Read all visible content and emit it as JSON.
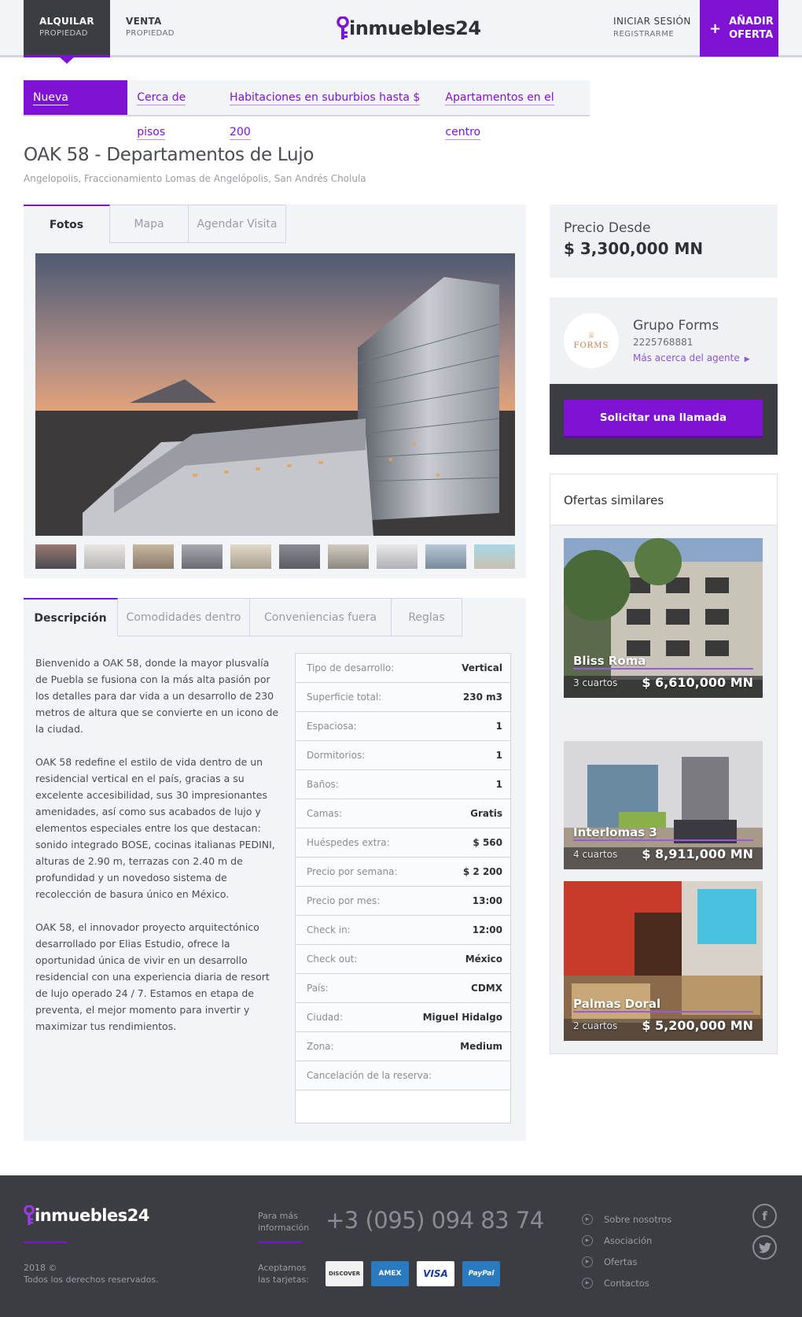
{
  "header": {
    "rent": {
      "title": "ALQUILAR",
      "subtitle": "PROPIEDAD"
    },
    "sale": {
      "title": "VENTA",
      "subtitle": "PROPIEDAD"
    },
    "logo": "inmuebles24",
    "login": "INICIAR SESIÓN",
    "register": "REGISTRARME",
    "add_offer": {
      "plus": "+",
      "line1": "AÑADIR",
      "line2": "OFERTA"
    },
    "accent": "#7f13d4"
  },
  "search_tabs": [
    {
      "label": "Nueva búsqueda",
      "active": true
    },
    {
      "label": "Cerca de pisos"
    },
    {
      "label": "Habitaciones en suburbios hasta $ 200"
    },
    {
      "label": "Apartamentos en el centro"
    }
  ],
  "listing": {
    "title": "OAK 58 - Departamentos de Lujo",
    "address": "Angelopolis, Fraccionamiento Lomas de Angelópolis, San Andrés Cholula"
  },
  "media_tabs": [
    {
      "label": "Fotos",
      "active": true
    },
    {
      "label": "Mapa"
    },
    {
      "label": "Agendar Visita"
    }
  ],
  "desc_tabs": [
    {
      "label": "Descripción",
      "active": true
    },
    {
      "label": "Comodidades dentro"
    },
    {
      "label": "Conveniencias fuera"
    },
    {
      "label": "Reglas"
    }
  ],
  "description": [
    "Bienvenido a OAK 58, donde la mayor plusvalía de Puebla se fusiona con la más alta pasión por los detalles para dar vida a un desarrollo de 230 metros de altura que se convierte en un icono de la ciudad.",
    "OAK 58 redefine el estilo de vida dentro de un residencial vertical en el país, gracias a su excelente accesibilidad, sus 30 impresionantes amenidades, así como sus acabados de lujo y elementos especiales entre los que destacan: sonido integrado BOSE, cocinas italianas PEDINI, alturas de 2.90 m, terrazas con 2.40 m de profundidad y un novedoso sistema de recolección de basura único en México.",
    "OAK 58, el innovador proyecto arquitectónico desarrollado por Elias Estudio, ofrece la oportunidad única de vivir en un desarrollo residencial con una experiencia diaria de resort de lujo operado 24 / 7. Estamos en etapa de preventa, el mejor momento para invertir y maximizar tus rendimientos."
  ],
  "specs": [
    {
      "k": "Tipo de desarrollo:",
      "v": "Vertical"
    },
    {
      "k": "Superficie total:",
      "v": "230 m3"
    },
    {
      "k": "Espaciosa:",
      "v": "1"
    },
    {
      "k": "Dormitorios:",
      "v": "1"
    },
    {
      "k": "Baños:",
      "v": "1"
    },
    {
      "k": "Camas:",
      "v": "Gratis"
    },
    {
      "k": "Huéspedes extra:",
      "v": "$ 560"
    },
    {
      "k": "Precio por semana:",
      "v": "$ 2 200"
    },
    {
      "k": "Precio por mes:",
      "v": "13:00"
    },
    {
      "k": "Check in:",
      "v": "12:00"
    },
    {
      "k": "Check out:",
      "v": "México"
    },
    {
      "k": "País:",
      "v": "CDMX"
    },
    {
      "k": "Ciudad:",
      "v": "Miguel Hidalgo"
    },
    {
      "k": "Zona:",
      "v": "Medium"
    },
    {
      "k": "Cancelación de la reserva:",
      "v": ""
    }
  ],
  "price": {
    "label": "Precio Desde",
    "value": "$ 3,300,000 MN"
  },
  "agent": {
    "name": "Grupo Forms",
    "phone": "2225768881",
    "more": "Más acerca del agente",
    "logo_text": "FORMS"
  },
  "call_button": "Solicitar una llamada",
  "similar": {
    "heading": "Ofertas similares",
    "items": [
      {
        "title": "Bliss Roma",
        "rooms": "3 cuartos",
        "price": "$ 6,610,000 MN"
      },
      {
        "title": "Interlomas 3",
        "rooms": "4 cuartos",
        "price": "$ 8,911,000 MN"
      },
      {
        "title": "Palmas Doral",
        "rooms": "2 cuartos",
        "price": "$ 5,200,000 MN"
      }
    ]
  },
  "footer": {
    "logo": "inmuebles24",
    "year": "2018 ©",
    "rights": "Todos los derechos reservados.",
    "info_label": "Para más información",
    "phone": "+3 (095) 094 83 74",
    "cards_label": "Aceptamos las tarjetas:",
    "cards": [
      "DISCOVER",
      "AMEX",
      "VISA",
      "PayPal"
    ],
    "links": [
      "Sobre nosotros",
      "Asociación",
      "Ofertas",
      "Contactos"
    ],
    "social": [
      "facebook-icon",
      "twitter-icon"
    ]
  }
}
